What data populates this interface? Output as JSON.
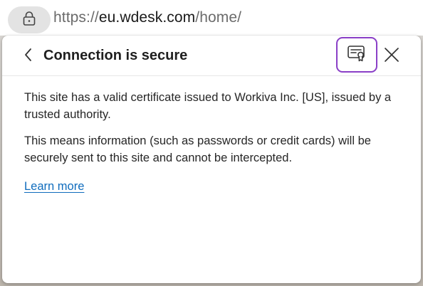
{
  "address_bar": {
    "url_scheme": "https://",
    "url_host": "eu.wdesk.com",
    "url_path": "/home/",
    "lock_icon": "lock-icon"
  },
  "popup": {
    "title": "Connection is secure",
    "back_icon": "chevron-left-icon",
    "certificate_icon": "certificate-icon",
    "close_icon": "close-icon",
    "paragraph_1": "This site has a valid certificate issued to Workiva Inc. [US], issued by a trusted authority.",
    "paragraph_2": "This means information (such as passwords or credit cards) will be securely sent to this site and cannot be intercepted.",
    "learn_more": "Learn more"
  },
  "colors": {
    "focus_outline": "#8a3fc7",
    "link": "#0f6cbd"
  }
}
